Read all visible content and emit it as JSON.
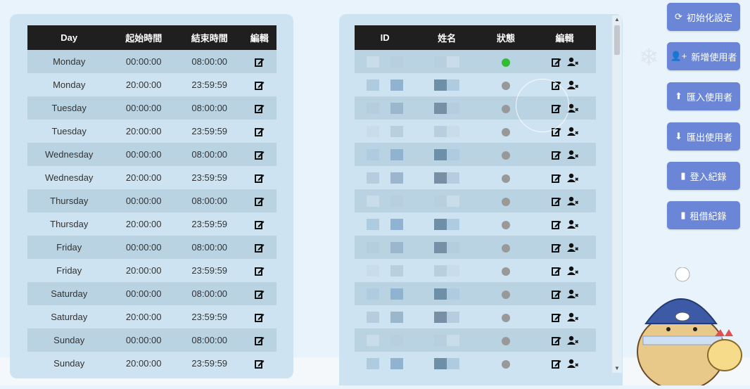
{
  "schedule": {
    "headers": [
      "Day",
      "起始時間",
      "結束時間",
      "編輯"
    ],
    "rows": [
      {
        "day": "Monday",
        "start": "00:00:00",
        "end": "08:00:00"
      },
      {
        "day": "Monday",
        "start": "20:00:00",
        "end": "23:59:59"
      },
      {
        "day": "Tuesday",
        "start": "00:00:00",
        "end": "08:00:00"
      },
      {
        "day": "Tuesday",
        "start": "20:00:00",
        "end": "23:59:59"
      },
      {
        "day": "Wednesday",
        "start": "00:00:00",
        "end": "08:00:00"
      },
      {
        "day": "Wednesday",
        "start": "20:00:00",
        "end": "23:59:59"
      },
      {
        "day": "Thursday",
        "start": "00:00:00",
        "end": "08:00:00"
      },
      {
        "day": "Thursday",
        "start": "20:00:00",
        "end": "23:59:59"
      },
      {
        "day": "Friday",
        "start": "00:00:00",
        "end": "08:00:00"
      },
      {
        "day": "Friday",
        "start": "20:00:00",
        "end": "23:59:59"
      },
      {
        "day": "Saturday",
        "start": "00:00:00",
        "end": "08:00:00"
      },
      {
        "day": "Saturday",
        "start": "20:00:00",
        "end": "23:59:59"
      },
      {
        "day": "Sunday",
        "start": "00:00:00",
        "end": "08:00:00"
      },
      {
        "day": "Sunday",
        "start": "20:00:00",
        "end": "23:59:59"
      }
    ]
  },
  "users": {
    "headers": [
      "ID",
      "姓名",
      "狀態",
      "編輯"
    ],
    "rows": [
      {
        "status": "active"
      },
      {
        "status": "inactive"
      },
      {
        "status": "inactive"
      },
      {
        "status": "inactive"
      },
      {
        "status": "inactive"
      },
      {
        "status": "inactive"
      },
      {
        "status": "inactive"
      },
      {
        "status": "inactive"
      },
      {
        "status": "inactive"
      },
      {
        "status": "inactive"
      },
      {
        "status": "inactive"
      },
      {
        "status": "inactive"
      },
      {
        "status": "inactive"
      },
      {
        "status": "inactive"
      }
    ]
  },
  "colors": {
    "status_active": "#33bb33",
    "status_inactive": "#999999",
    "button": "#6b86d6",
    "header": "#1f1f1f"
  },
  "side_buttons": [
    {
      "label": "初始化設定",
      "icon": "refresh-icon"
    },
    {
      "label": "新增使用者",
      "icon": "add-user-icon"
    },
    {
      "label": "匯入使用者",
      "icon": "upload-icon"
    },
    {
      "label": "匯出使用者",
      "icon": "download-icon"
    },
    {
      "label": "登入紀錄",
      "icon": "file-icon"
    },
    {
      "label": "租借紀錄",
      "icon": "file-icon"
    }
  ]
}
